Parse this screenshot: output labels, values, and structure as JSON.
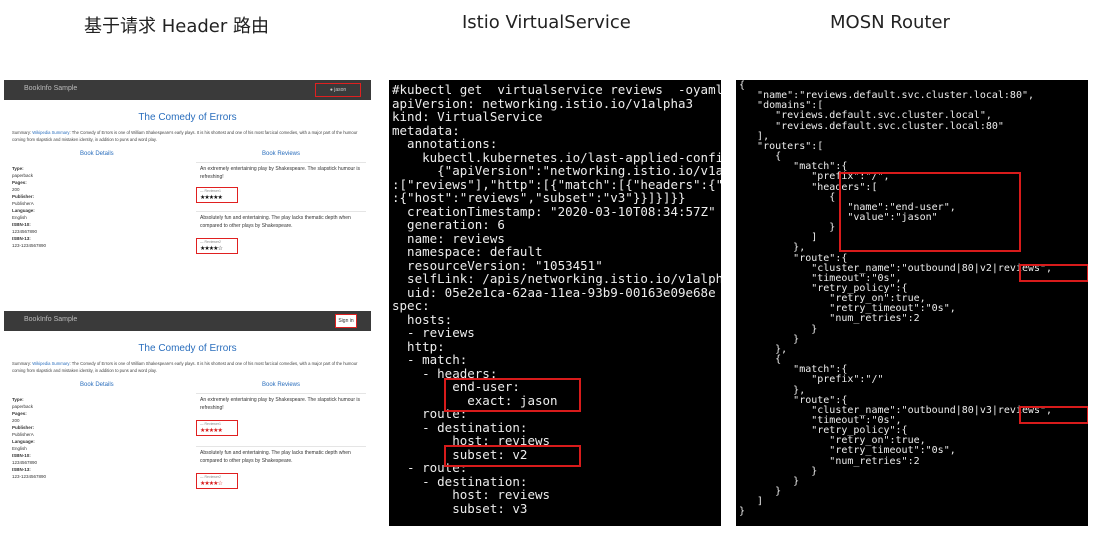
{
  "titles": {
    "left": "基于请求 Header 路由",
    "middle": "Istio VirtualService",
    "right": "MOSN Router"
  },
  "bookinfo": {
    "brand": "BookInfo Sample",
    "user_label": "jason",
    "sign_in": "Sign in",
    "book_title": "The Comedy of Errors",
    "summary_label": "Summary:",
    "summary_link": "Wikipedia Summary",
    "summary_text": ": The Comedy of Errors is one of William Shakespeare's early plays. It is his shortest and one of his most farcical comedies, with a major part of the humour coming from slapstick and mistaken identity, in addition to puns and word play.",
    "details_heading": "Book Details",
    "reviews_heading": "Book Reviews",
    "details": [
      {
        "key": "Type:",
        "value": "paperback"
      },
      {
        "key": "Pages:",
        "value": "200"
      },
      {
        "key": "Publisher:",
        "value": "PublisherA"
      },
      {
        "key": "Language:",
        "value": "English"
      },
      {
        "key": "ISBN-10:",
        "value": "1234567890"
      },
      {
        "key": "ISBN-13:",
        "value": "123-1234567890"
      }
    ],
    "reviews": [
      {
        "text": "An extremely entertaining play by Shakespeare. The slapstick humour is refreshing!",
        "reviewer": "— Reviewer1",
        "rating": 5
      },
      {
        "text": "Absolutely fun and entertaining. The play lacks thematic depth when compared to other plays by Shakespeare.",
        "reviewer": "— Reviewer2",
        "rating": 4
      }
    ],
    "star_color_top": "#111111",
    "star_color_bottom": "#d81b1b"
  },
  "terminal": {
    "lines": [
      "#kubectl get  virtualservice reviews  -oyaml",
      "apiVersion: networking.istio.io/v1alpha3",
      "kind: VirtualService",
      "metadata:",
      "  annotations:",
      "    kubectl.kubernetes.io/last-applied-confi",
      "      {\"apiVersion\":\"networking.istio.io/v1a",
      ":[\"reviews\"],\"http\":[{\"match\":[{\"headers\":{\"",
      ":{\"host\":\"reviews\",\"subset\":\"v3\"}}]}]}}",
      "  creationTimestamp: \"2020-03-10T08:34:57Z\"",
      "  generation: 6",
      "  name: reviews",
      "  namespace: default",
      "  resourceVersion: \"1053451\"",
      "  selfLink: /apis/networking.istio.io/v1alph",
      "  uid: 05e2e1ca-62aa-11ea-93b9-00163e09e68e",
      "spec:",
      "  hosts:",
      "  - reviews",
      "  http:",
      "  - match:",
      "    - headers:",
      "        end-user:",
      "          exact: jason",
      "    route:",
      "    - destination:",
      "        host: reviews",
      "        subset: v2",
      "  - route:",
      "    - destination:",
      "        host: reviews",
      "        subset: v3"
    ]
  },
  "router_json": {
    "lines": [
      "{",
      "   \"name\":\"reviews.default.svc.cluster.local:80\",",
      "   \"domains\":[",
      "      \"reviews.default.svc.cluster.local\",",
      "      \"reviews.default.svc.cluster.local:80\"",
      "   ],",
      "   \"routers\":[",
      "      {",
      "         \"match\":{",
      "            \"prefix\":\"/\",",
      "            \"headers\":[",
      "               {",
      "                  \"name\":\"end-user\",",
      "                  \"value\":\"jason\"",
      "               }",
      "            ]",
      "         },",
      "         \"route\":{",
      "            \"cluster_name\":\"outbound|80|v2|reviews\",",
      "            \"timeout\":\"0s\",",
      "            \"retry_policy\":{",
      "               \"retry_on\":true,",
      "               \"retry_timeout\":\"0s\",",
      "               \"num_retries\":2",
      "            }",
      "         }",
      "      },",
      "      {",
      "         \"match\":{",
      "            \"prefix\":\"/\"",
      "         },",
      "         \"route\":{",
      "            \"cluster_name\":\"outbound|80|v3|reviews\",",
      "            \"timeout\":\"0s\",",
      "            \"retry_policy\":{",
      "               \"retry_on\":true,",
      "               \"retry_timeout\":\"0s\",",
      "               \"num_retries\":2",
      "            }",
      "         }",
      "      }",
      "   ]",
      "}"
    ]
  },
  "highlight_color": "#d81b1b"
}
